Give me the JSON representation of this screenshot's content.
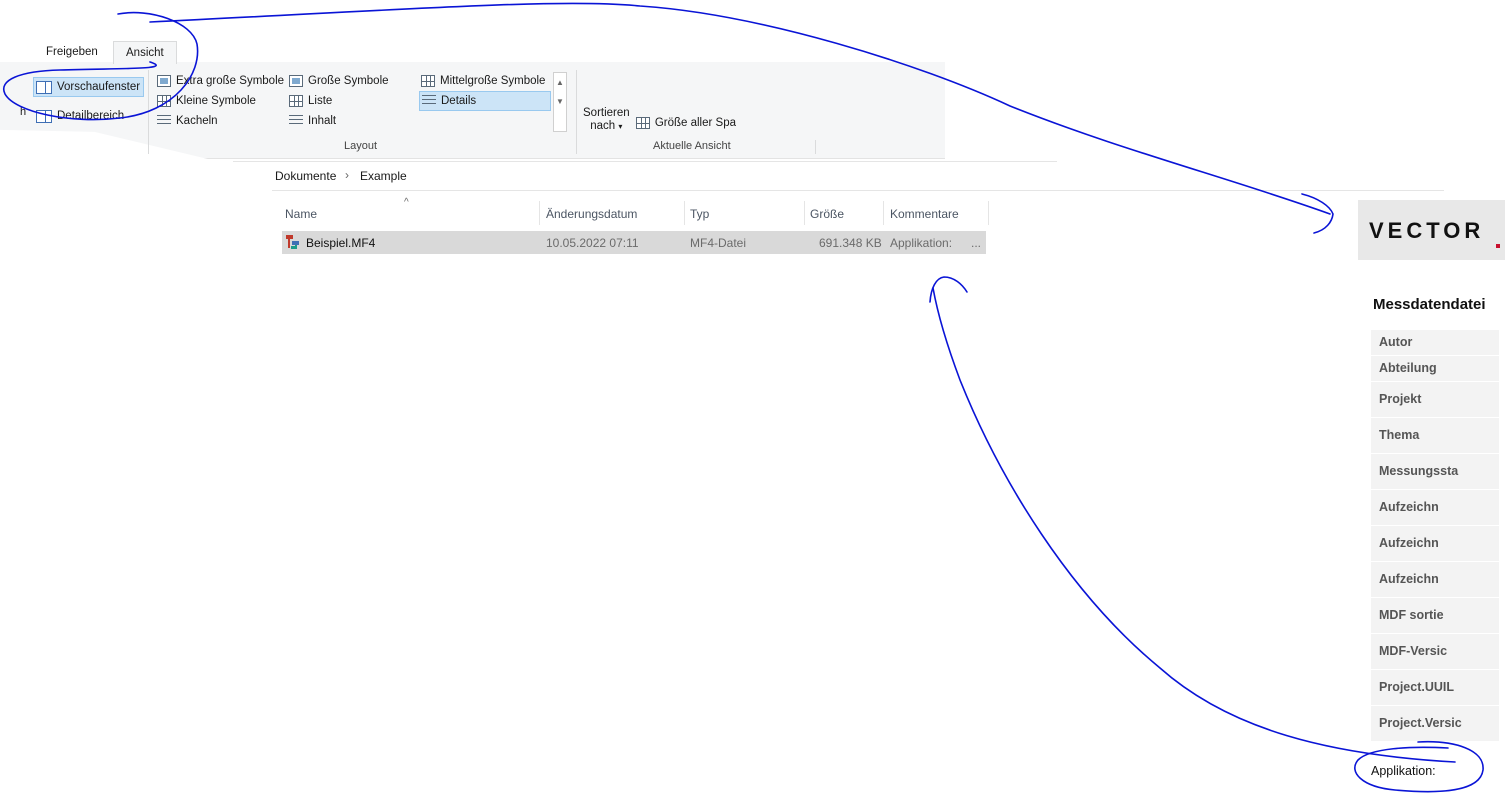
{
  "ribbon": {
    "tabs": [
      "Freigeben",
      "Ansicht"
    ],
    "panes": {
      "preview": "Vorschaufenster",
      "details": "Detailbereich",
      "cut_label": "h"
    },
    "layout": {
      "extra_large": "Extra große Symbole",
      "large": "Große Symbole",
      "medium": "Mittelgroße Symbole",
      "small": "Kleine Symbole",
      "list": "Liste",
      "details": "Details",
      "tiles": "Kacheln",
      "content": "Inhalt",
      "group_label": "Layout"
    },
    "current_view": {
      "sort_line1": "Sortieren",
      "sort_line2": "nach",
      "fit_columns": "Größe aller Spa",
      "group_label": "Aktuelle Ansicht"
    }
  },
  "breadcrumb": {
    "items": [
      "Dokumente",
      "Example"
    ],
    "separator": "›"
  },
  "columns": {
    "name": "Name",
    "date": "Änderungsdatum",
    "type": "Typ",
    "size": "Größe",
    "comment": "Kommentare",
    "sort_indicator": "^"
  },
  "files": [
    {
      "name": "Beispiel.MF4",
      "date": "10.05.2022 07:11",
      "type": "MF4-Datei",
      "size": "691.348 KB",
      "comment": "Applikation:",
      "more": "..."
    }
  ],
  "preview": {
    "logo": "VECTOR",
    "title": "Messdatendatei",
    "rows": [
      "Autor",
      "Abteilung",
      "Projekt",
      "Thema",
      "Messungssta",
      "Aufzeichn",
      "Aufzeichn",
      "Aufzeichn",
      "MDF sortie",
      "MDF-Versic",
      "Project.UUIL",
      "Project.Versic"
    ],
    "footer": "Applikation:"
  },
  "colors": {
    "ink": "#0a14d6",
    "selection": "#cce4f7",
    "row_selected": "#d9d9d9",
    "brand_red": "#c8102e"
  }
}
